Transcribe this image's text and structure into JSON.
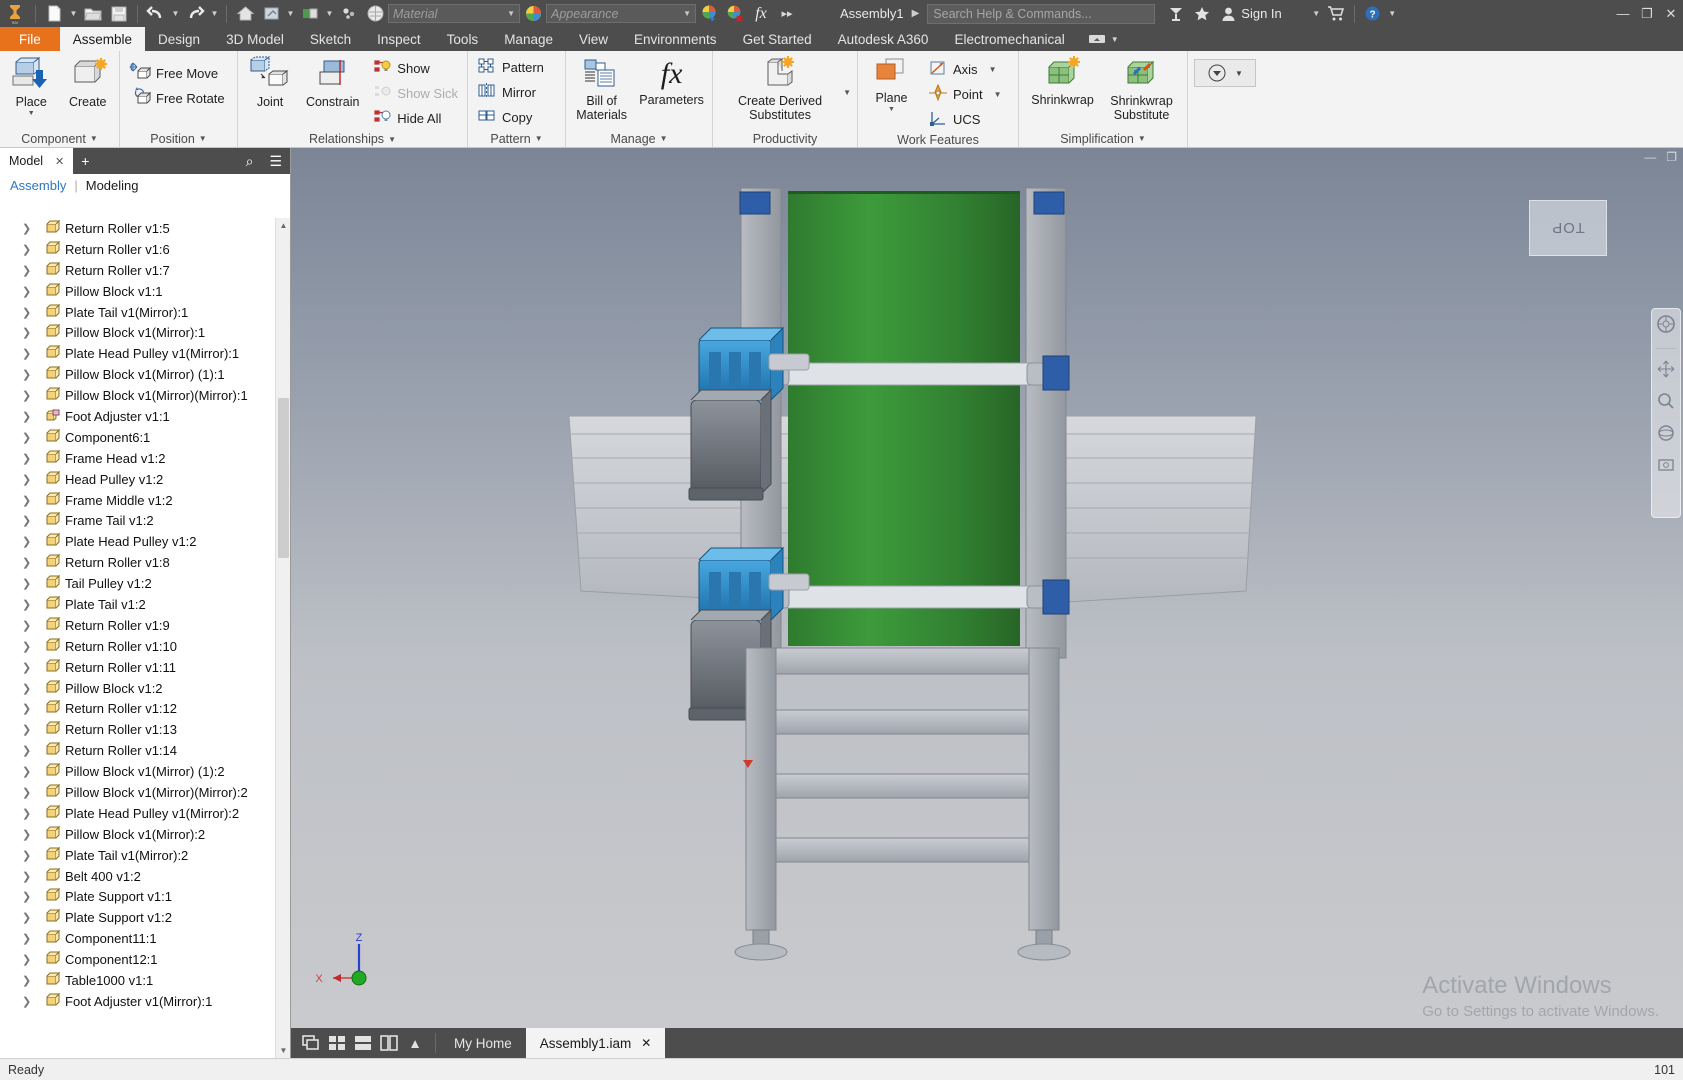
{
  "titlebar": {
    "app_icon": "inventor-logo-icon",
    "quick_access": [
      {
        "name": "new-file-icon",
        "glyph": "🗋",
        "dropdown": true
      },
      {
        "name": "open-file-icon",
        "glyph": "📂",
        "dropdown": false
      },
      {
        "name": "save-icon",
        "glyph": "💾",
        "dropdown": false
      },
      {
        "name": "undo-icon",
        "glyph": "↶",
        "dropdown": true
      },
      {
        "name": "redo-icon",
        "glyph": "↷",
        "dropdown": true
      }
    ],
    "quick_access2": [
      {
        "name": "home-icon",
        "glyph": "⌂",
        "dropdown": false
      },
      {
        "name": "return-icon",
        "glyph": "⤡",
        "dropdown": true
      },
      {
        "name": "update-icon",
        "glyph": "▤",
        "dropdown": true
      },
      {
        "name": "select-icon",
        "glyph": "∴",
        "dropdown": false
      },
      {
        "name": "material-sphere-icon",
        "glyph": "●",
        "dropdown": false
      }
    ],
    "material_value": "Material",
    "appearance_value": "Appearance",
    "fx_label": "fx",
    "more_label": "▸▸",
    "document_title": "Assembly1",
    "search_placeholder": "Search Help & Commands...",
    "signin_label": "Sign In",
    "window_controls": [
      "—",
      "❐",
      "✕"
    ]
  },
  "ribbon_tabs": [
    {
      "label": "File",
      "state": "file"
    },
    {
      "label": "Assemble",
      "state": "active"
    },
    {
      "label": "Design",
      "state": "normal"
    },
    {
      "label": "3D Model",
      "state": "normal"
    },
    {
      "label": "Sketch",
      "state": "normal"
    },
    {
      "label": "Inspect",
      "state": "normal"
    },
    {
      "label": "Tools",
      "state": "normal"
    },
    {
      "label": "Manage",
      "state": "normal"
    },
    {
      "label": "View",
      "state": "normal"
    },
    {
      "label": "Environments",
      "state": "normal"
    },
    {
      "label": "Get Started",
      "state": "normal"
    },
    {
      "label": "Autodesk A360",
      "state": "normal"
    },
    {
      "label": "Electromechanical",
      "state": "normal"
    }
  ],
  "ribbon_panels": {
    "component": {
      "title": "Component",
      "place_label": "Place",
      "create_label": "Create"
    },
    "position": {
      "title": "Position",
      "free_move_label": "Free Move",
      "free_rotate_label": "Free Rotate"
    },
    "relationships": {
      "title": "Relationships",
      "joint_label": "Joint",
      "constrain_label": "Constrain",
      "show_label": "Show",
      "show_sick_label": "Show Sick",
      "hide_all_label": "Hide All"
    },
    "pattern": {
      "title": "Pattern",
      "pattern_label": "Pattern",
      "mirror_label": "Mirror",
      "copy_label": "Copy"
    },
    "manage": {
      "title": "Manage",
      "bom_label": "Bill of\nMaterials",
      "bom_line1": "Bill of",
      "bom_line2": "Materials",
      "parameters_label": "Parameters"
    },
    "productivity": {
      "title": "Productivity",
      "derived_line1": "Create Derived",
      "derived_line2": "Substitutes"
    },
    "work_features": {
      "title": "Work Features",
      "plane_label": "Plane",
      "axis_label": "Axis",
      "point_label": "Point",
      "ucs_label": "UCS"
    },
    "simplification": {
      "title": "Simplification",
      "shrinkwrap_label": "Shrinkwrap",
      "shrinkwrap_sub_line1": "Shrinkwrap",
      "shrinkwrap_sub_line2": "Substitute"
    }
  },
  "browser": {
    "tab_label": "Model",
    "close_glyph": "✕",
    "plus_glyph": "+",
    "search_glyph": "⌕",
    "menu_glyph": "☰",
    "filter_assembly": "Assembly",
    "filter_divider": "|",
    "filter_modeling": "Modeling",
    "tree_items": [
      {
        "label": "Return Roller v1:5",
        "icon": "part-icon"
      },
      {
        "label": "Return Roller v1:6",
        "icon": "part-icon"
      },
      {
        "label": "Return Roller v1:7",
        "icon": "part-icon"
      },
      {
        "label": "Pillow Block v1:1",
        "icon": "part-icon"
      },
      {
        "label": "Plate Tail v1(Mirror):1",
        "icon": "part-icon"
      },
      {
        "label": "Pillow Block v1(Mirror):1",
        "icon": "part-icon"
      },
      {
        "label": "Plate Head Pulley v1(Mirror):1",
        "icon": "part-icon"
      },
      {
        "label": "Pillow Block v1(Mirror) (1):1",
        "icon": "part-icon"
      },
      {
        "label": "Pillow Block v1(Mirror)(Mirror):1",
        "icon": "part-icon"
      },
      {
        "label": "Foot Adjuster v1:1",
        "icon": "assembly-icon"
      },
      {
        "label": "Component6:1",
        "icon": "part-icon"
      },
      {
        "label": "Frame Head v1:2",
        "icon": "part-icon"
      },
      {
        "label": "Head Pulley v1:2",
        "icon": "part-icon"
      },
      {
        "label": "Frame Middle v1:2",
        "icon": "part-icon"
      },
      {
        "label": "Frame Tail v1:2",
        "icon": "part-icon"
      },
      {
        "label": "Plate Head Pulley v1:2",
        "icon": "part-icon"
      },
      {
        "label": "Return Roller v1:8",
        "icon": "part-icon"
      },
      {
        "label": "Tail Pulley v1:2",
        "icon": "part-icon"
      },
      {
        "label": "Plate Tail v1:2",
        "icon": "part-icon"
      },
      {
        "label": "Return Roller v1:9",
        "icon": "part-icon"
      },
      {
        "label": "Return Roller v1:10",
        "icon": "part-icon"
      },
      {
        "label": "Return Roller v1:11",
        "icon": "part-icon"
      },
      {
        "label": "Pillow Block v1:2",
        "icon": "part-icon"
      },
      {
        "label": "Return Roller v1:12",
        "icon": "part-icon"
      },
      {
        "label": "Return Roller v1:13",
        "icon": "part-icon"
      },
      {
        "label": "Return Roller v1:14",
        "icon": "part-icon"
      },
      {
        "label": "Pillow Block v1(Mirror) (1):2",
        "icon": "part-icon"
      },
      {
        "label": "Pillow Block v1(Mirror)(Mirror):2",
        "icon": "part-icon"
      },
      {
        "label": "Plate Head Pulley v1(Mirror):2",
        "icon": "part-icon"
      },
      {
        "label": "Pillow Block v1(Mirror):2",
        "icon": "part-icon"
      },
      {
        "label": "Plate Tail v1(Mirror):2",
        "icon": "part-icon"
      },
      {
        "label": "Belt 400 v1:2",
        "icon": "part-icon"
      },
      {
        "label": "Plate Support v1:1",
        "icon": "part-icon"
      },
      {
        "label": "Plate Support v1:2",
        "icon": "part-icon"
      },
      {
        "label": "Component11:1",
        "icon": "part-icon"
      },
      {
        "label": "Component12:1",
        "icon": "part-icon"
      },
      {
        "label": "Table1000 v1:1",
        "icon": "part-icon"
      },
      {
        "label": "Foot Adjuster v1(Mirror):1",
        "icon": "part-icon"
      }
    ]
  },
  "viewport": {
    "viewcube_label": "TOP",
    "nav_icons": [
      "steering-wheel-icon",
      "pan-icon",
      "zoom-icon",
      "orbit-icon",
      "look-icon"
    ],
    "axis_x_label": "X",
    "axis_z_label": "Z",
    "watermark_line1": "Activate Windows",
    "watermark_line2": "Go to Settings to activate Windows.",
    "minimize_glyph": "—",
    "restore_glyph": "❐"
  },
  "doc_tabs": {
    "view_icons": [
      "cascade-icon",
      "tile-grid-icon",
      "tile-horizontal-icon",
      "tile-vertical-icon"
    ],
    "collapse_glyph": "▲",
    "tabs": [
      {
        "label": "My Home",
        "active": false,
        "closable": false
      },
      {
        "label": "Assembly1.iam",
        "active": true,
        "closable": true
      }
    ],
    "close_glyph": "✕"
  },
  "statusbar": {
    "message": "Ready",
    "right_text": "101"
  },
  "colors": {
    "accent_orange": "#e8721c",
    "ribbon_bg": "#f3f3f3",
    "chrome_dark": "#4d4d4d",
    "link_blue": "#2b79c2",
    "belt_green": "#3b8c3b",
    "motor_blue": "#2a8fd4"
  }
}
